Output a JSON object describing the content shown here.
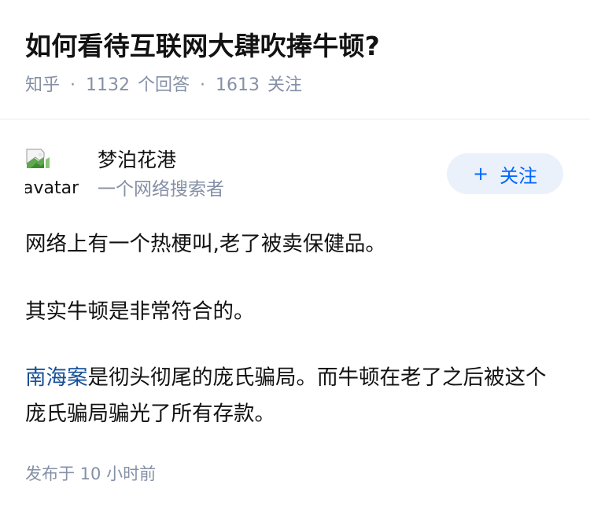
{
  "question": {
    "title": "如何看待互联网大肆吹捧牛顿?",
    "source": "知乎",
    "separator": "·",
    "answer_count": "1132",
    "answer_label": "个回答",
    "follower_count": "1613",
    "follower_label": "关注"
  },
  "author": {
    "avatar_alt": "avatar",
    "name": "梦泊花港",
    "headline": "一个网络搜索者",
    "follow_icon": "plus-icon",
    "follow_plus": "+",
    "follow_label": "关注"
  },
  "answer": {
    "paragraphs": [
      "网络上有一个热梗叫,老了被卖保健品。",
      "其实牛顿是非常符合的。"
    ],
    "para3_link": "南海案",
    "para3_rest": "是彻头彻尾的庞氏骗局。而牛顿在老了之后被这个庞氏骗局骗光了所有存款。",
    "published": "发布于 10 小时前"
  },
  "colors": {
    "text": "#121212",
    "meta": "#8590a6",
    "accent": "#0066ff",
    "follow_bg": "#ebf1fb",
    "link": "#175199"
  }
}
